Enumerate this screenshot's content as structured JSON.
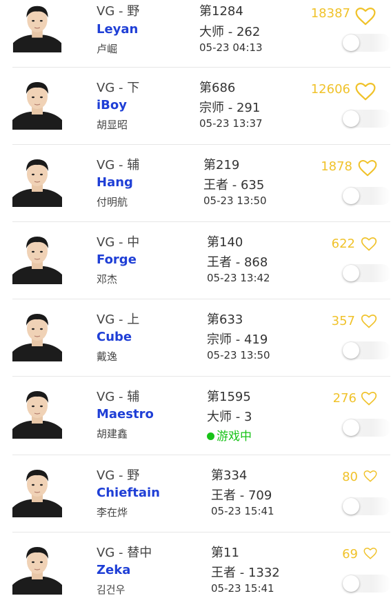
{
  "players": [
    {
      "team_pos": "VG - 野",
      "name": "Leyan",
      "real_name": "卢崛",
      "rank": "第1284",
      "tier": "大师 - 262",
      "time": "05-23 04:13",
      "status": "",
      "likes": "18387",
      "follow": false
    },
    {
      "team_pos": "VG - 下",
      "name": "iBoy",
      "real_name": "胡显昭",
      "rank": "第686",
      "tier": "宗师 - 291",
      "time": "05-23 13:37",
      "status": "",
      "likes": "12606",
      "follow": false
    },
    {
      "team_pos": "VG - 辅",
      "name": "Hang",
      "real_name": "付明航",
      "rank": "第219",
      "tier": "王者 - 635",
      "time": "05-23 13:50",
      "status": "",
      "likes": "1878",
      "follow": false
    },
    {
      "team_pos": "VG - 中",
      "name": "Forge",
      "real_name": "邓杰",
      "rank": "第140",
      "tier": "王者 - 868",
      "time": "05-23 13:42",
      "status": "",
      "likes": "622",
      "follow": false
    },
    {
      "team_pos": "VG - 上",
      "name": "Cube",
      "real_name": "戴逸",
      "rank": "第633",
      "tier": "宗师 - 419",
      "time": "05-23 13:50",
      "status": "",
      "likes": "357",
      "follow": false
    },
    {
      "team_pos": "VG - 辅",
      "name": "Maestro",
      "real_name": "胡建鑫",
      "rank": "第1595",
      "tier": "大师 - 3",
      "time": "",
      "status": "游戏中",
      "likes": "276",
      "follow": false
    },
    {
      "team_pos": "VG - 野",
      "name": "Chieftain",
      "real_name": "李在烨",
      "rank": "第334",
      "tier": "王者 - 709",
      "time": "05-23 15:41",
      "status": "",
      "likes": "80",
      "follow": false
    },
    {
      "team_pos": "VG - 替中",
      "name": "Zeka",
      "real_name": "김건우",
      "rank": "第11",
      "tier": "王者 - 1332",
      "time": "05-23 15:41",
      "status": "",
      "likes": "69",
      "follow": false
    }
  ],
  "colors": {
    "name": "#1f3fd6",
    "likes": "#f0c22a",
    "status": "#17c317"
  },
  "icons": {
    "like": "heart-outline-icon",
    "avatar": "player-portrait"
  }
}
